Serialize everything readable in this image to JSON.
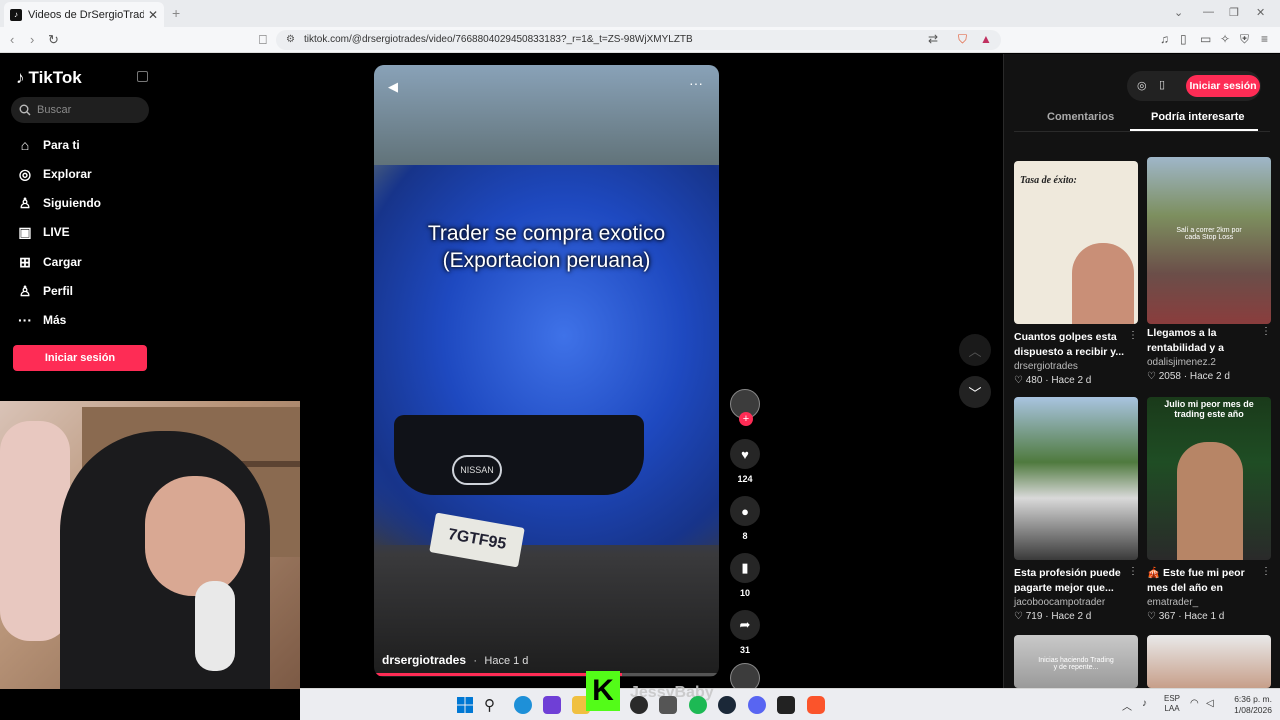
{
  "browser": {
    "tab_title": "Videos de DrSergioTrades (@dr...",
    "new_tab": "+",
    "url": "tiktok.com/@drsergiotrades/video/7668804029450833183?_r=1&_t=ZS-98WjXMYLZTB"
  },
  "sidebar": {
    "logo": "TikTok",
    "search_placeholder": "Buscar",
    "items": [
      {
        "label": "Para ti",
        "icon": "home-icon"
      },
      {
        "label": "Explorar",
        "icon": "compass-icon"
      },
      {
        "label": "Siguiendo",
        "icon": "following-icon"
      },
      {
        "label": "LIVE",
        "icon": "live-icon"
      },
      {
        "label": "Cargar",
        "icon": "upload-icon"
      },
      {
        "label": "Perfil",
        "icon": "profile-icon"
      },
      {
        "label": "Más",
        "icon": "more-icon"
      }
    ],
    "login_button": "Iniciar sesión"
  },
  "video": {
    "caption_line1": "Trader se compra exotico",
    "caption_line2": "(Exportacion peruana)",
    "author": "drsergiotrades",
    "time": "Hace 1 d",
    "plate": "7GTF95",
    "badge": "NISSAN",
    "progress": 0.72
  },
  "actions": {
    "likes": "124",
    "comments": "8",
    "saves": "10",
    "shares": "31"
  },
  "right_panel": {
    "login_button": "Iniciar sesión",
    "tabs": [
      "Comentarios",
      "Podría interesarte"
    ],
    "active_tab": 1,
    "cards": [
      {
        "title": "Cuantos golpes esta dispuesto a recibir y...",
        "author": "drsergiotrades",
        "likes": "480",
        "time": "Hace 2 d",
        "thumb_text": "Tasa de éxito:"
      },
      {
        "title": "Llegamos a la rentabilidad y a runne...",
        "author": "odalisjimenez.2",
        "likes": "2058",
        "time": "Hace 2 d",
        "thumb_text": "Salí a correr 2km por cada Stop Loss"
      },
      {
        "title": "Esta profesión puede pagarte mejor que...",
        "author": "jacoboocampotrader",
        "likes": "719",
        "time": "Hace 2 d",
        "thumb_text": ""
      },
      {
        "title": "🎪 Este fue mi peor mes del año en tradin...",
        "author": "ematrader_",
        "likes": "367",
        "time": "Hace 1 d",
        "thumb_text": "Julio mi peor mes de trading este año"
      },
      {
        "title": "",
        "author": "",
        "likes": "",
        "time": "",
        "thumb_text": "Inicias haciendo Trading y de repente..."
      },
      {
        "title": "",
        "author": "",
        "likes": "",
        "time": "",
        "thumb_text": ""
      }
    ]
  },
  "taskbar": {
    "overlay_name": "JessyBaby",
    "kick_letter": "K",
    "lang_top": "ESP",
    "lang_bottom": "LAA",
    "time": "6:36 p. m.",
    "date": "1/08/2026"
  },
  "colors": {
    "accent": "#fe2c55",
    "kick_green": "#53fc18"
  }
}
